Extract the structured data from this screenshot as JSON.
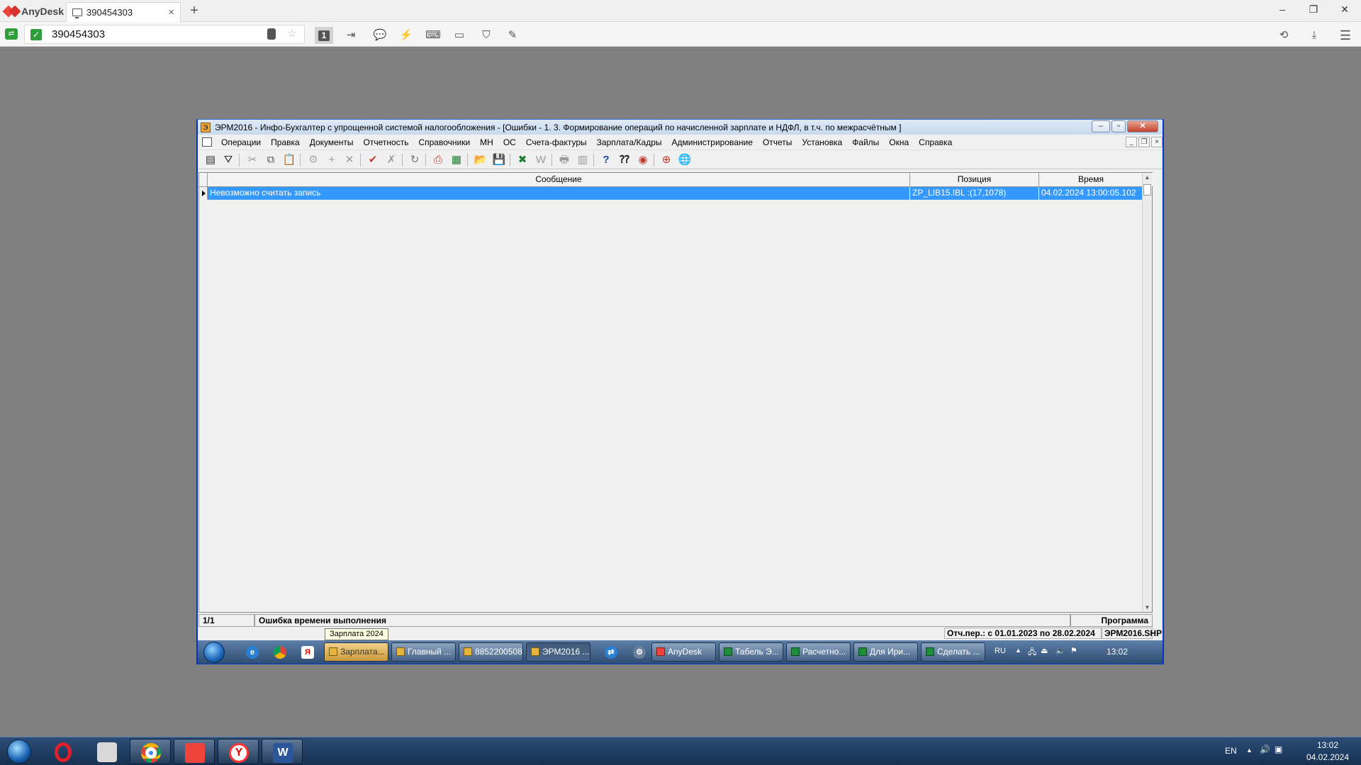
{
  "anydesk": {
    "brand": "AnyDesk",
    "tab_label": "390454303",
    "new_tab": "+",
    "address": "390454303",
    "window_controls": [
      "–",
      "❐",
      "✕"
    ]
  },
  "app": {
    "title": "ЭРМ2016 - Инфо-Бухгалтер с упрощенной системой налогообложения - [Ошибки - 1. 3. Формирование операций по начисленной зарплате и НДФЛ, в т.ч. по межрасчётным ]",
    "menu": [
      "Операции",
      "Правка",
      "Документы",
      "Отчетность",
      "Справочники",
      "МН",
      "ОС",
      "Счета-фактуры",
      "Зарплата/Кадры",
      "Администрирование",
      "Отчеты",
      "Установка",
      "Файлы",
      "Окна",
      "Справка"
    ],
    "grid": {
      "headers": [
        "Сообщение",
        "Позиция",
        "Время"
      ],
      "rows": [
        {
          "message": "Невозможно считать запись",
          "position": "ZP_LIB15.IBL :(17,1078)",
          "time": "04.02.2024 13:00:05.102"
        }
      ]
    },
    "status": {
      "counter": "1/1",
      "message": "Ошибка времени выполнения",
      "right": "Программа",
      "period": "Отч.пер.: с 01.01.2023 по 28.02.2024",
      "file": "ЭРМ2016.SHP"
    },
    "tooltip": "Зарплата 2024"
  },
  "remote_taskbar": {
    "tasks": [
      "Зарплата...",
      "Главный ...",
      "8852200508",
      "ЭРМ2016 ...",
      "AnyDesk",
      "Табель Э...",
      "Расчетно...",
      "Для Ири...",
      "Сделать ..."
    ],
    "lang": "RU",
    "time": "13:02"
  },
  "host_taskbar": {
    "lang": "EN",
    "time": "13:02",
    "date": "04.02.2024"
  },
  "colors": {
    "selection": "#3399ff",
    "anydesk_red": "#ef443b"
  }
}
